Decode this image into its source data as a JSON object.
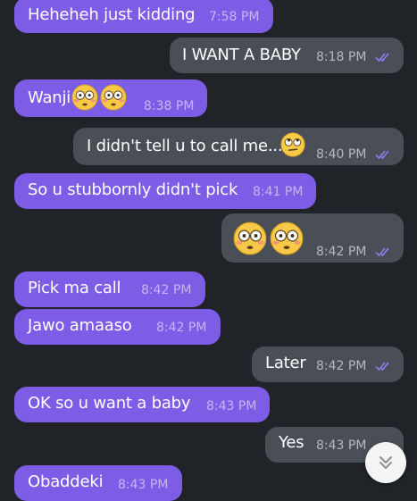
{
  "messages": [
    {
      "direction": "incoming",
      "text": "Heheheh just kidding",
      "time": "7:58 PM"
    },
    {
      "direction": "outgoing",
      "text": "I WANT A BABY",
      "time": "8:18 PM",
      "status": "read"
    },
    {
      "direction": "incoming",
      "text": "Wanji",
      "emoji": [
        "flushed-face",
        "flushed-face"
      ],
      "time": "8:38 PM"
    },
    {
      "direction": "outgoing",
      "text": "I didn't tell u to call me...",
      "emoji": [
        "face-with-rolling-eyes"
      ],
      "time": "8:40 PM",
      "status": "read"
    },
    {
      "direction": "incoming",
      "text": "So u stubbornly didn't pick",
      "time": "8:41 PM"
    },
    {
      "direction": "outgoing",
      "text": "",
      "emoji": [
        "flushed-face",
        "flushed-face"
      ],
      "time": "8:42 PM",
      "status": "read"
    },
    {
      "direction": "incoming",
      "text": "Pick ma call",
      "time": "8:42 PM"
    },
    {
      "direction": "incoming",
      "text": "Jawo amaaso",
      "time": "8:42 PM"
    },
    {
      "direction": "outgoing",
      "text": "Later",
      "time": "8:42 PM",
      "status": "read"
    },
    {
      "direction": "incoming",
      "text": "OK so u want a baby",
      "time": "8:43 PM"
    },
    {
      "direction": "outgoing",
      "text": "Yes",
      "time": "8:43 PM",
      "status": "read"
    },
    {
      "direction": "incoming",
      "text": "Obaddeki",
      "time": "8:43 PM"
    }
  ],
  "colors": {
    "background": "#202328",
    "incoming_bubble": "#7d5ce6",
    "outgoing_bubble": "#4a4f57",
    "read_ticks": "#8f7bf0"
  },
  "icons": {
    "read_receipt": "double-check-icon",
    "scroll_down": "double-chevron-down-icon"
  }
}
